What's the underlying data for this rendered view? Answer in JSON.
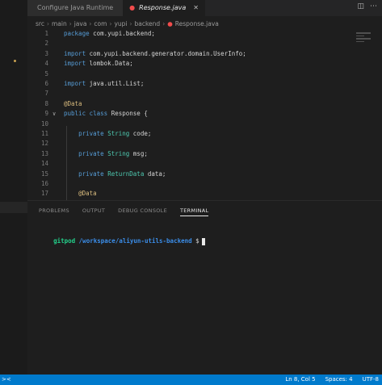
{
  "tabs": [
    {
      "label": "Configure Java Runtime",
      "active": false
    },
    {
      "label": "Response.java",
      "active": true
    }
  ],
  "breadcrumb": [
    "src",
    "main",
    "java",
    "com",
    "yupi",
    "backend",
    "Response.java"
  ],
  "code_lines": [
    {
      "num": "1",
      "tokens": [
        {
          "t": "kw",
          "v": "package"
        },
        {
          "t": "",
          "v": " com.yupi.backend;"
        }
      ]
    },
    {
      "num": "2",
      "tokens": []
    },
    {
      "num": "3",
      "tokens": [
        {
          "t": "kw",
          "v": "import"
        },
        {
          "t": "",
          "v": " com.yupi.backend.generator.domain.UserInfo;"
        }
      ]
    },
    {
      "num": "4",
      "tokens": [
        {
          "t": "kw",
          "v": "import"
        },
        {
          "t": "",
          "v": " lombok.Data;"
        }
      ]
    },
    {
      "num": "5",
      "tokens": []
    },
    {
      "num": "6",
      "tokens": [
        {
          "t": "kw",
          "v": "import"
        },
        {
          "t": "",
          "v": " java.util.List;"
        }
      ]
    },
    {
      "num": "7",
      "tokens": []
    },
    {
      "num": "8",
      "tokens": [
        {
          "t": "an",
          "v": "@Data"
        }
      ]
    },
    {
      "num": "9",
      "tokens": [
        {
          "t": "kw",
          "v": "public class"
        },
        {
          "t": "",
          "v": " Response {"
        }
      ],
      "fold": true
    },
    {
      "num": "10",
      "tokens": []
    },
    {
      "num": "11",
      "tokens": [
        {
          "t": "",
          "v": "    "
        },
        {
          "t": "kw",
          "v": "private"
        },
        {
          "t": "",
          "v": " "
        },
        {
          "t": "ty",
          "v": "String"
        },
        {
          "t": "",
          "v": " code;"
        }
      ]
    },
    {
      "num": "12",
      "tokens": []
    },
    {
      "num": "13",
      "tokens": [
        {
          "t": "",
          "v": "    "
        },
        {
          "t": "kw",
          "v": "private"
        },
        {
          "t": "",
          "v": " "
        },
        {
          "t": "ty",
          "v": "String"
        },
        {
          "t": "",
          "v": " msg;"
        }
      ]
    },
    {
      "num": "14",
      "tokens": []
    },
    {
      "num": "15",
      "tokens": [
        {
          "t": "",
          "v": "    "
        },
        {
          "t": "kw",
          "v": "private"
        },
        {
          "t": "",
          "v": " "
        },
        {
          "t": "ty",
          "v": "ReturnData"
        },
        {
          "t": "",
          "v": " data;"
        }
      ]
    },
    {
      "num": "16",
      "tokens": []
    },
    {
      "num": "17",
      "tokens": [
        {
          "t": "",
          "v": "    "
        },
        {
          "t": "an",
          "v": "@Data"
        }
      ]
    }
  ],
  "panel": {
    "tabs": [
      "PROBLEMS",
      "OUTPUT",
      "DEBUG CONSOLE",
      "TERMINAL"
    ],
    "active_tab": "TERMINAL"
  },
  "terminal": {
    "user": "gitpod",
    "path": "/workspace/aliyun-utils-backend",
    "prompt": "$"
  },
  "status": {
    "position": "Ln 8, Col 5",
    "spaces": "Spaces: 4",
    "encoding": "UTF-8"
  },
  "colors": {
    "statusbar": "#007acc",
    "keyword": "#569cd6",
    "type": "#4ec9b0",
    "annotation": "#d7ba7d",
    "terminal_user": "#23d18b",
    "terminal_path": "#3b8eea"
  }
}
